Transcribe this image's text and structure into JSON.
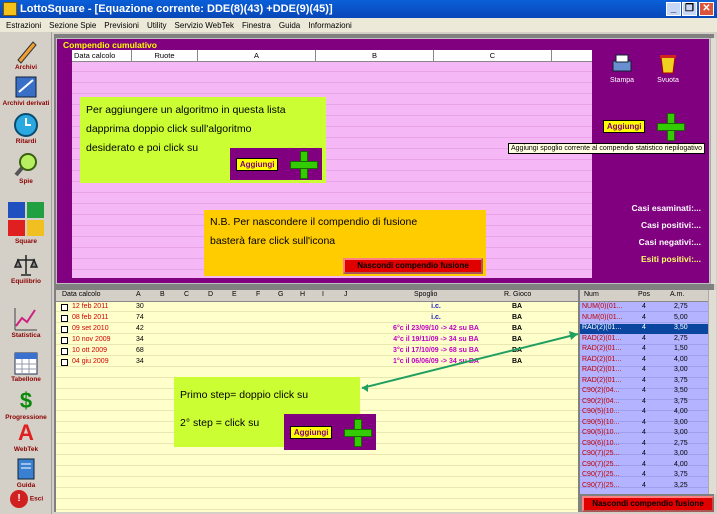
{
  "window": {
    "title": "LottoSquare - [Equazione corrente: DDE(8)(43) +DDE(9)(45)]",
    "controls": [
      "_",
      "❐",
      "✕"
    ]
  },
  "menu": [
    "Estrazioni",
    "Sezione Spie",
    "Previsioni",
    "Utility",
    "Servizio WebTek",
    "Finestra",
    "Guida",
    "Informazioni"
  ],
  "sidebar": [
    {
      "label": "Archivi",
      "icon": "pencil-icon"
    },
    {
      "label": "Archivi derivati",
      "icon": "archive-icon"
    },
    {
      "label": "Ritardi",
      "icon": "clock-icon"
    },
    {
      "label": "Spie",
      "icon": "magnifier-icon"
    },
    {
      "label": "Square",
      "icon": "squares-icon"
    },
    {
      "label": "Equilibrio",
      "icon": "scales-icon"
    },
    {
      "label": "Statistica",
      "icon": "chart-icon"
    },
    {
      "label": "Tabellone",
      "icon": "calendar-icon"
    },
    {
      "label": "Progressione",
      "icon": "dollar-icon"
    },
    {
      "label": "WebTek",
      "icon": "webtek-icon"
    },
    {
      "label": "Guida",
      "icon": "guide-icon"
    },
    {
      "label": "Esci",
      "icon": "exit-icon"
    }
  ],
  "compendio": {
    "caption": "Compendio cumulativo",
    "headers": [
      "Data calcolo",
      "Ruote",
      "A",
      "B",
      "C"
    ],
    "stampa": "Stampa",
    "svuota": "Svuota",
    "aggiungi": "Aggiungi",
    "tooltip": "Aggiungi spoglio corrente al compendio statistico riepilogativo",
    "stats": [
      "Casi esaminati:...",
      "Casi positivi:...",
      "Casi negativi:...",
      "Esiti positivi:..."
    ],
    "callout1": [
      "Per aggiungere un algoritmo in questa lista",
      "dapprima doppio click sull'algoritmo",
      "desiderato e poi click su"
    ],
    "nb": [
      "N.B. Per nascondere il compendio di fusione",
      "basterà fare click sull'icona"
    ],
    "hide_btn": "Nascondi compendio fusione"
  },
  "lower": {
    "headers": [
      "Data calcolo",
      "A",
      "B",
      "C",
      "D",
      "E",
      "F",
      "G",
      "H",
      "I",
      "J",
      "Spoglio",
      "R. Gioco"
    ],
    "rows": [
      {
        "date": "12 feb 2011",
        "a": "30",
        "spoglio": "i.c.",
        "gioco": "BA"
      },
      {
        "date": "08 feb 2011",
        "a": "74",
        "spoglio": "i.c.",
        "gioco": "BA"
      },
      {
        "date": "09 set 2010",
        "a": "42",
        "spoglio": "6°c il 23/09/10 -> 42 su BA",
        "gioco": "BA"
      },
      {
        "date": "10 nov 2009",
        "a": "34",
        "spoglio": "4°c il 19/11/09 -> 34 su BA",
        "gioco": "BA"
      },
      {
        "date": "10 ott 2009",
        "a": "68",
        "spoglio": "3°c il 17/10/09 -> 68 su BA",
        "gioco": "BA"
      },
      {
        "date": "04 giu 2009",
        "a": "34",
        "spoglio": "1°c il 06/06/09 -> 34 su BA",
        "gioco": "BA"
      }
    ],
    "step1": "Primo step= doppio click su",
    "step2": "2° step = click su"
  },
  "right": {
    "headers": [
      "Num",
      "Pos",
      "A.m."
    ],
    "rows": [
      [
        "NUM(0)(01...",
        "4",
        "2,75"
      ],
      [
        "NUM(0)(01...",
        "4",
        "5,00"
      ],
      [
        "RAD(2)(01...",
        "4",
        "3,50"
      ],
      [
        "RAD(2)(01...",
        "4",
        "2,75"
      ],
      [
        "RAD(2)(01...",
        "4",
        "1,50"
      ],
      [
        "RAD(2)(01...",
        "4",
        "4,00"
      ],
      [
        "RAD(2)(01...",
        "4",
        "3,00"
      ],
      [
        "RAD(2)(01...",
        "4",
        "3,75"
      ],
      [
        "C90(2)(04...",
        "4",
        "3,50"
      ],
      [
        "C90(2)(04...",
        "4",
        "3,75"
      ],
      [
        "C90(5)(10...",
        "4",
        "4,00"
      ],
      [
        "C90(5)(10...",
        "4",
        "3,00"
      ],
      [
        "C90(5)(10...",
        "4",
        "3,00"
      ],
      [
        "C90(6)(10...",
        "4",
        "2,75"
      ],
      [
        "C90(7)(25...",
        "4",
        "3,00"
      ],
      [
        "C90(7)(25...",
        "4",
        "4,00"
      ],
      [
        "C90(7)(25...",
        "4",
        "3,75"
      ],
      [
        "C90(7)(25...",
        "4",
        "3,25"
      ]
    ],
    "hide_btn": "Nascondi compendio fusione"
  }
}
